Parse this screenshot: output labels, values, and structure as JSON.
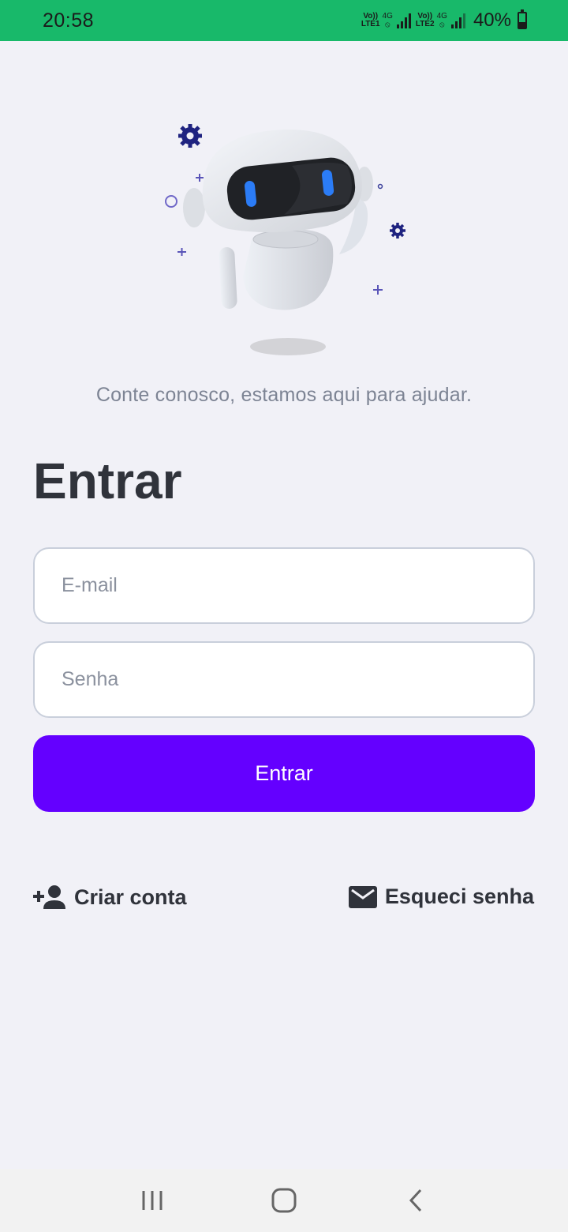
{
  "status_bar": {
    "time": "20:58",
    "sim1_label_top": "Vo))",
    "sim1_label_bottom": "LTE1",
    "sim2_label_top": "Vo))",
    "sim2_label_bottom": "LTE2",
    "network_type": "4G",
    "battery_percent": "40%",
    "battery_level": 0.4,
    "background_color": "#18b96a"
  },
  "hero": {
    "image": "robot-assistant-illustration",
    "tagline": "Conte conosco, estamos aqui para ajudar."
  },
  "login_form": {
    "title": "Entrar",
    "email_placeholder": "E-mail",
    "email_value": "",
    "password_placeholder": "Senha",
    "password_value": "",
    "submit_label": "Entrar",
    "accent_color": "#6400ff"
  },
  "links": {
    "create_account": {
      "label": "Criar conta",
      "icon": "person-add-icon"
    },
    "forgot_password": {
      "label": "Esqueci senha",
      "icon": "envelope-icon"
    }
  },
  "nav_bar": {
    "recents_icon": "recents-icon",
    "home_icon": "home-icon",
    "back_icon": "back-icon"
  }
}
